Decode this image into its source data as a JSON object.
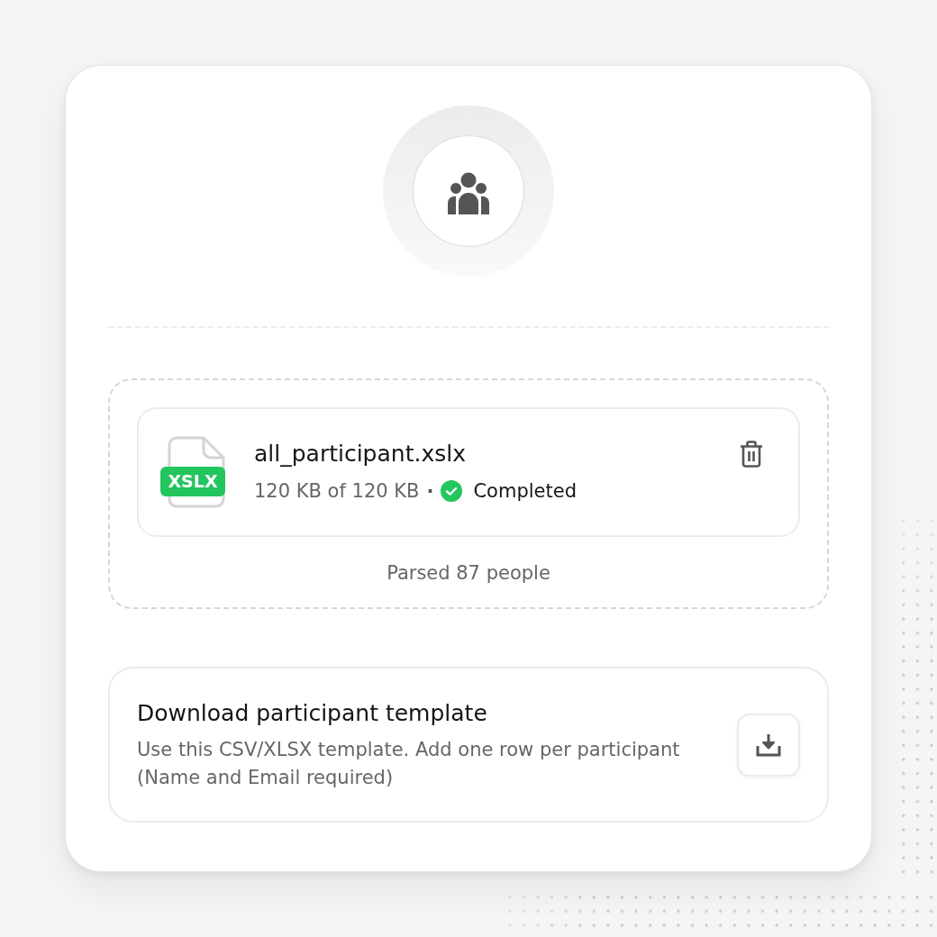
{
  "file": {
    "name": "all_participant.xslx",
    "badge": "XSLX",
    "size": "120 KB of 120 KB",
    "separator": "·",
    "status": {
      "kind": "completed",
      "label": "Completed"
    }
  },
  "dropzone": {
    "summary": "Parsed 87 people"
  },
  "template": {
    "title": "Download participant template",
    "description": "Use this CSV/XLSX template. Add one row per participant (Name and Email required)"
  }
}
